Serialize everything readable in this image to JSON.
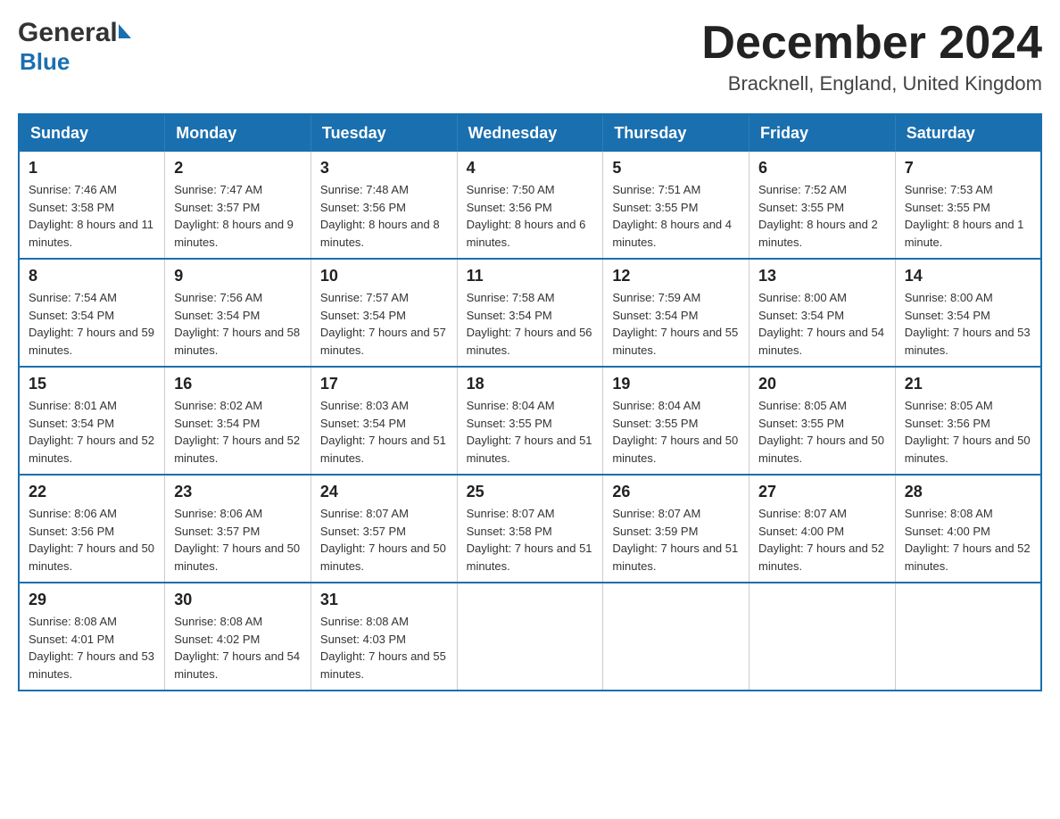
{
  "logo": {
    "general": "General",
    "blue": "Blue"
  },
  "header": {
    "month": "December 2024",
    "location": "Bracknell, England, United Kingdom"
  },
  "weekdays": [
    "Sunday",
    "Monday",
    "Tuesday",
    "Wednesday",
    "Thursday",
    "Friday",
    "Saturday"
  ],
  "weeks": [
    [
      {
        "day": "1",
        "sunrise": "7:46 AM",
        "sunset": "3:58 PM",
        "daylight": "8 hours and 11 minutes."
      },
      {
        "day": "2",
        "sunrise": "7:47 AM",
        "sunset": "3:57 PM",
        "daylight": "8 hours and 9 minutes."
      },
      {
        "day": "3",
        "sunrise": "7:48 AM",
        "sunset": "3:56 PM",
        "daylight": "8 hours and 8 minutes."
      },
      {
        "day": "4",
        "sunrise": "7:50 AM",
        "sunset": "3:56 PM",
        "daylight": "8 hours and 6 minutes."
      },
      {
        "day": "5",
        "sunrise": "7:51 AM",
        "sunset": "3:55 PM",
        "daylight": "8 hours and 4 minutes."
      },
      {
        "day": "6",
        "sunrise": "7:52 AM",
        "sunset": "3:55 PM",
        "daylight": "8 hours and 2 minutes."
      },
      {
        "day": "7",
        "sunrise": "7:53 AM",
        "sunset": "3:55 PM",
        "daylight": "8 hours and 1 minute."
      }
    ],
    [
      {
        "day": "8",
        "sunrise": "7:54 AM",
        "sunset": "3:54 PM",
        "daylight": "7 hours and 59 minutes."
      },
      {
        "day": "9",
        "sunrise": "7:56 AM",
        "sunset": "3:54 PM",
        "daylight": "7 hours and 58 minutes."
      },
      {
        "day": "10",
        "sunrise": "7:57 AM",
        "sunset": "3:54 PM",
        "daylight": "7 hours and 57 minutes."
      },
      {
        "day": "11",
        "sunrise": "7:58 AM",
        "sunset": "3:54 PM",
        "daylight": "7 hours and 56 minutes."
      },
      {
        "day": "12",
        "sunrise": "7:59 AM",
        "sunset": "3:54 PM",
        "daylight": "7 hours and 55 minutes."
      },
      {
        "day": "13",
        "sunrise": "8:00 AM",
        "sunset": "3:54 PM",
        "daylight": "7 hours and 54 minutes."
      },
      {
        "day": "14",
        "sunrise": "8:00 AM",
        "sunset": "3:54 PM",
        "daylight": "7 hours and 53 minutes."
      }
    ],
    [
      {
        "day": "15",
        "sunrise": "8:01 AM",
        "sunset": "3:54 PM",
        "daylight": "7 hours and 52 minutes."
      },
      {
        "day": "16",
        "sunrise": "8:02 AM",
        "sunset": "3:54 PM",
        "daylight": "7 hours and 52 minutes."
      },
      {
        "day": "17",
        "sunrise": "8:03 AM",
        "sunset": "3:54 PM",
        "daylight": "7 hours and 51 minutes."
      },
      {
        "day": "18",
        "sunrise": "8:04 AM",
        "sunset": "3:55 PM",
        "daylight": "7 hours and 51 minutes."
      },
      {
        "day": "19",
        "sunrise": "8:04 AM",
        "sunset": "3:55 PM",
        "daylight": "7 hours and 50 minutes."
      },
      {
        "day": "20",
        "sunrise": "8:05 AM",
        "sunset": "3:55 PM",
        "daylight": "7 hours and 50 minutes."
      },
      {
        "day": "21",
        "sunrise": "8:05 AM",
        "sunset": "3:56 PM",
        "daylight": "7 hours and 50 minutes."
      }
    ],
    [
      {
        "day": "22",
        "sunrise": "8:06 AM",
        "sunset": "3:56 PM",
        "daylight": "7 hours and 50 minutes."
      },
      {
        "day": "23",
        "sunrise": "8:06 AM",
        "sunset": "3:57 PM",
        "daylight": "7 hours and 50 minutes."
      },
      {
        "day": "24",
        "sunrise": "8:07 AM",
        "sunset": "3:57 PM",
        "daylight": "7 hours and 50 minutes."
      },
      {
        "day": "25",
        "sunrise": "8:07 AM",
        "sunset": "3:58 PM",
        "daylight": "7 hours and 51 minutes."
      },
      {
        "day": "26",
        "sunrise": "8:07 AM",
        "sunset": "3:59 PM",
        "daylight": "7 hours and 51 minutes."
      },
      {
        "day": "27",
        "sunrise": "8:07 AM",
        "sunset": "4:00 PM",
        "daylight": "7 hours and 52 minutes."
      },
      {
        "day": "28",
        "sunrise": "8:08 AM",
        "sunset": "4:00 PM",
        "daylight": "7 hours and 52 minutes."
      }
    ],
    [
      {
        "day": "29",
        "sunrise": "8:08 AM",
        "sunset": "4:01 PM",
        "daylight": "7 hours and 53 minutes."
      },
      {
        "day": "30",
        "sunrise": "8:08 AM",
        "sunset": "4:02 PM",
        "daylight": "7 hours and 54 minutes."
      },
      {
        "day": "31",
        "sunrise": "8:08 AM",
        "sunset": "4:03 PM",
        "daylight": "7 hours and 55 minutes."
      },
      null,
      null,
      null,
      null
    ]
  ],
  "labels": {
    "sunrise_prefix": "Sunrise: ",
    "sunset_prefix": "Sunset: ",
    "daylight_prefix": "Daylight: "
  }
}
